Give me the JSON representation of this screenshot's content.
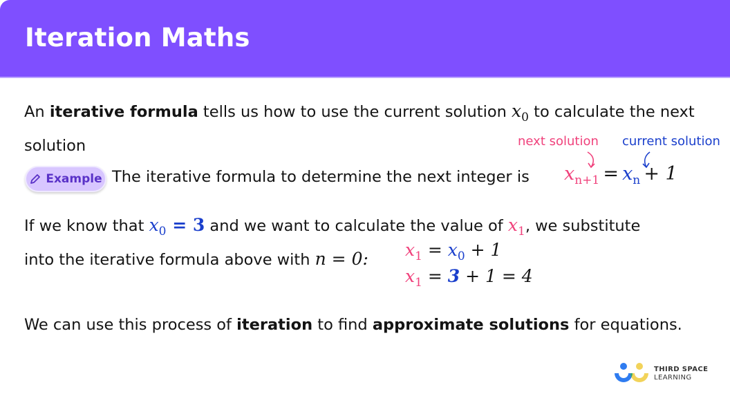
{
  "header": {
    "title": "Iteration Maths",
    "background_color": "#7f4fff"
  },
  "intro": {
    "part1": "An ",
    "bold1": "iterative formula",
    "part2": " tells us how to use the current solution ",
    "math_var": "x",
    "math_sub": "0",
    "part3": " to calculate the next solution"
  },
  "annotations": {
    "next_solution": "next solution",
    "current_solution": "current solution",
    "next_color": "#f0427c",
    "current_color": "#1a3fcc"
  },
  "example": {
    "badge_label": "Example",
    "badge_icon": "pencil-icon",
    "text": "The iterative formula to determine the next integer is",
    "formula": {
      "lhs_var": "x",
      "lhs_sub": "n+1",
      "equals": "=",
      "rhs_var": "x",
      "rhs_sub": "n",
      "rhs_rest": "+ 1"
    }
  },
  "substitution": {
    "text1": "If we know that ",
    "given_var": "x",
    "given_sub": "0",
    "given_eq": " = 3",
    "text2": " and we want to calculate the value of ",
    "target_var": "x",
    "target_sub": "1",
    "text3": ", we substitute",
    "text4": "into the iterative formula above with ",
    "n_eq": "n = 0:",
    "line1": {
      "lhs_var": "x",
      "lhs_sub": "1",
      "eq": " = ",
      "rhs_var": "x",
      "rhs_sub": "0",
      "rest": " + 1"
    },
    "line2": {
      "lhs_var": "x",
      "lhs_sub": "1",
      "eq": " = ",
      "value": "3",
      "rest": " + 1 = 4"
    }
  },
  "conclusion": {
    "text1": "We can use this process of ",
    "bold1": "iteration",
    "text2": " to find ",
    "bold2": "approximate solutions",
    "text3": " for equations."
  },
  "logo": {
    "line1": "THIRD SPACE",
    "line2": "LEARNING"
  }
}
